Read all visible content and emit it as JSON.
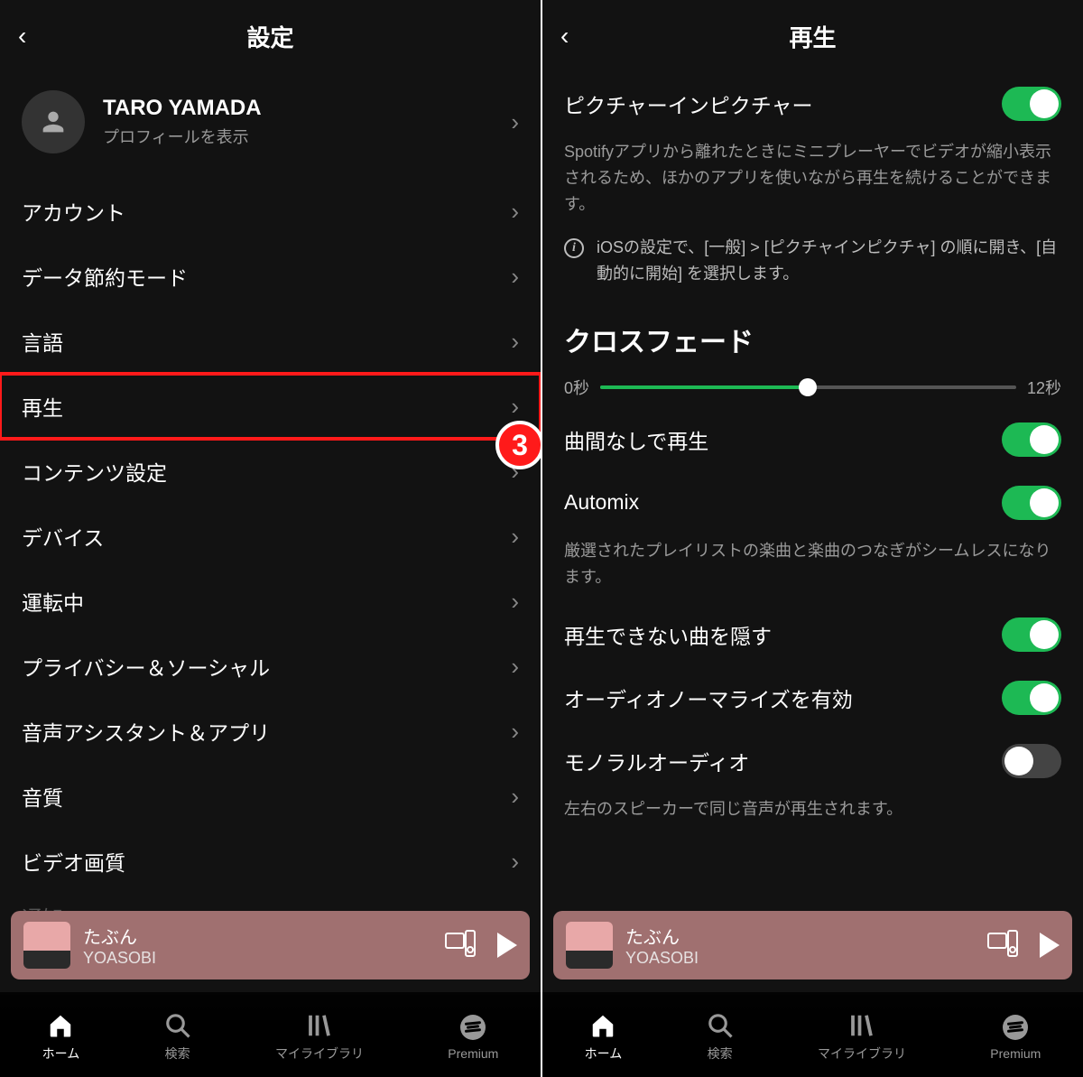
{
  "left": {
    "header_title": "設定",
    "profile": {
      "name": "TARO YAMADA",
      "sub": "プロフィールを表示"
    },
    "menu": [
      {
        "label": "アカウント"
      },
      {
        "label": "データ節約モード"
      },
      {
        "label": "言語"
      },
      {
        "label": "再生",
        "highlight": true,
        "step": "3"
      },
      {
        "label": "コンテンツ設定"
      },
      {
        "label": "デバイス"
      },
      {
        "label": "運転中"
      },
      {
        "label": "プライバシー＆ソーシャル"
      },
      {
        "label": "音声アシスタント＆アプリ"
      },
      {
        "label": "音質"
      },
      {
        "label": "ビデオ画質"
      }
    ],
    "faded_next": "通知"
  },
  "right": {
    "header_title": "再生",
    "pip": {
      "label": "ピクチャーインピクチャー",
      "on": true,
      "desc": "Spotifyアプリから離れたときにミニプレーヤーでビデオが縮小表示されるため、ほかのアプリを使いながら再生を続けることができます。",
      "info": "iOSの設定で、[一般] > [ピクチャインピクチャ] の順に開き、[自動的に開始] を選択します。"
    },
    "crossfade": {
      "heading": "クロスフェード",
      "min": "0秒",
      "max": "12秒"
    },
    "toggles": [
      {
        "label": "曲間なしで再生",
        "on": true
      },
      {
        "label": "Automix",
        "on": true,
        "desc": "厳選されたプレイリストの楽曲と楽曲のつなぎがシームレスになります。"
      },
      {
        "label": "再生できない曲を隠す",
        "on": true
      },
      {
        "label": "オーディオノーマライズを有効",
        "on": true
      },
      {
        "label": "モノラルオーディオ",
        "on": false,
        "desc": "左右のスピーカーで同じ音声が再生されます。"
      }
    ]
  },
  "nowplaying": {
    "song": "たぶん",
    "artist": "YOASOBI"
  },
  "tabs": [
    {
      "label": "ホーム",
      "icon": "home",
      "active": true
    },
    {
      "label": "検索",
      "icon": "search"
    },
    {
      "label": "マイライブラリ",
      "icon": "library"
    },
    {
      "label": "Premium",
      "icon": "spotify"
    }
  ]
}
